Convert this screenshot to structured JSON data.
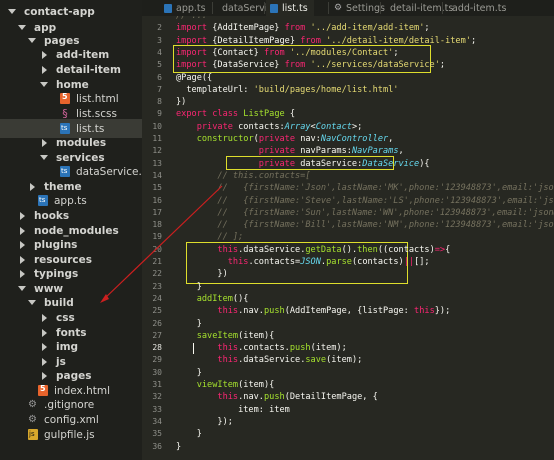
{
  "sidebar": {
    "items": [
      {
        "label": "contact-app",
        "kind": "folder-open",
        "indent": 0,
        "bold": true
      },
      {
        "label": "app",
        "kind": "folder-open",
        "indent": 1,
        "bold": true
      },
      {
        "label": "pages",
        "kind": "folder-open",
        "indent": 2,
        "bold": true
      },
      {
        "label": "add-item",
        "kind": "folder-closed",
        "indent": 3,
        "bold": true
      },
      {
        "label": "detail-item",
        "kind": "folder-closed",
        "indent": 3,
        "bold": true
      },
      {
        "label": "home",
        "kind": "folder-open",
        "indent": 3,
        "bold": true
      },
      {
        "label": "list.html",
        "kind": "html",
        "indent": 4,
        "bold": false
      },
      {
        "label": "list.scss",
        "kind": "scss",
        "indent": 4,
        "bold": false
      },
      {
        "label": "list.ts",
        "kind": "ts",
        "indent": 4,
        "bold": false,
        "selected": true
      },
      {
        "label": "modules",
        "kind": "folder-closed",
        "indent": 3,
        "bold": true
      },
      {
        "label": "services",
        "kind": "folder-open",
        "indent": 3,
        "bold": true
      },
      {
        "label": "dataService.ts",
        "kind": "ts",
        "indent": 4,
        "bold": false
      },
      {
        "label": "theme",
        "kind": "folder-closed",
        "indent": 2,
        "bold": true
      },
      {
        "label": "app.ts",
        "kind": "ts",
        "indent": 2,
        "bold": false
      },
      {
        "label": "hooks",
        "kind": "folder-closed",
        "indent": 1,
        "bold": true
      },
      {
        "label": "node_modules",
        "kind": "folder-closed",
        "indent": 1,
        "bold": true
      },
      {
        "label": "plugins",
        "kind": "folder-closed",
        "indent": 1,
        "bold": true
      },
      {
        "label": "resources",
        "kind": "folder-closed",
        "indent": 1,
        "bold": true
      },
      {
        "label": "typings",
        "kind": "folder-closed",
        "indent": 1,
        "bold": true
      },
      {
        "label": "www",
        "kind": "folder-open",
        "indent": 1,
        "bold": true
      },
      {
        "label": "build",
        "kind": "folder-open",
        "indent": 2,
        "bold": true
      },
      {
        "label": "css",
        "kind": "folder-closed",
        "indent": 3,
        "bold": true
      },
      {
        "label": "fonts",
        "kind": "folder-closed",
        "indent": 3,
        "bold": true
      },
      {
        "label": "img",
        "kind": "folder-closed",
        "indent": 3,
        "bold": true
      },
      {
        "label": "js",
        "kind": "folder-closed",
        "indent": 3,
        "bold": true
      },
      {
        "label": "pages",
        "kind": "folder-closed",
        "indent": 3,
        "bold": true
      },
      {
        "label": "index.html",
        "kind": "html",
        "indent": 2,
        "bold": false
      },
      {
        "label": ".gitignore",
        "kind": "gear",
        "indent": 1,
        "bold": false
      },
      {
        "label": "config.xml",
        "kind": "gear",
        "indent": 1,
        "bold": false
      },
      {
        "label": "gulpfile.js",
        "kind": "js",
        "indent": 1,
        "bold": false
      }
    ]
  },
  "tabs": [
    {
      "label": "app.ts",
      "icon": "ts-file-icon",
      "active": false
    },
    {
      "label": "dataService",
      "icon": "ts-file-icon",
      "active": false
    },
    {
      "label": "list.ts",
      "icon": "ts-file-icon",
      "active": true
    },
    {
      "label": "Settings",
      "icon": "gear-icon",
      "active": false
    },
    {
      "label": "detail-item.ts",
      "icon": "ts-file-icon",
      "active": false
    },
    {
      "label": "add-item.ts",
      "icon": "ts-file-icon",
      "active": false
    }
  ],
  "editor": {
    "current_line": "28",
    "lines": [
      {
        "n": "",
        "tokens": [
          [
            "c",
            "// ..."
          ]
        ]
      },
      {
        "n": "2",
        "tokens": [
          [
            "k",
            "import"
          ],
          [
            "t",
            " {AddItemPage} "
          ],
          [
            "k",
            "from"
          ],
          [
            "t",
            " "
          ],
          [
            "s",
            "'../add-item/add-item'"
          ],
          [
            "t",
            ";"
          ]
        ]
      },
      {
        "n": "3",
        "tokens": [
          [
            "k",
            "import"
          ],
          [
            "t",
            " {DetailItemPage} "
          ],
          [
            "k",
            "from"
          ],
          [
            "t",
            " "
          ],
          [
            "s",
            "'../detail-item/detail-item'"
          ],
          [
            "t",
            ";"
          ]
        ]
      },
      {
        "n": "4",
        "tokens": [
          [
            "k",
            "import"
          ],
          [
            "t",
            " {Contact} "
          ],
          [
            "k",
            "from"
          ],
          [
            "t",
            " "
          ],
          [
            "s",
            "'../modules/Contact'"
          ],
          [
            "t",
            ";"
          ]
        ]
      },
      {
        "n": "5",
        "tokens": [
          [
            "k",
            "import"
          ],
          [
            "t",
            " {DataService} "
          ],
          [
            "k",
            "from"
          ],
          [
            "t",
            " "
          ],
          [
            "s",
            "'../services/dataService'"
          ],
          [
            "t",
            ";"
          ]
        ]
      },
      {
        "n": "6",
        "tokens": [
          [
            "t",
            "@Page({"
          ]
        ]
      },
      {
        "n": "7",
        "tokens": [
          [
            "t",
            "  templateUrl: "
          ],
          [
            "s",
            "'build/pages/home/list.html'"
          ]
        ]
      },
      {
        "n": "8",
        "tokens": [
          [
            "t",
            "})"
          ]
        ]
      },
      {
        "n": "9",
        "tokens": [
          [
            "k",
            "export"
          ],
          [
            "t",
            " "
          ],
          [
            "k",
            "class"
          ],
          [
            "t",
            " "
          ],
          [
            "f",
            "ListPage"
          ],
          [
            "t",
            " {"
          ]
        ]
      },
      {
        "n": "10",
        "tokens": [
          [
            "t",
            "    "
          ],
          [
            "k",
            "private"
          ],
          [
            "t",
            " contacts:"
          ],
          [
            "y",
            "Array"
          ],
          [
            "t",
            "<"
          ],
          [
            "y",
            "Contact"
          ],
          [
            "t",
            ">;"
          ]
        ]
      },
      {
        "n": "11",
        "tokens": [
          [
            "t",
            "    "
          ],
          [
            "f",
            "constructor"
          ],
          [
            "t",
            "("
          ],
          [
            "k",
            "private"
          ],
          [
            "t",
            " nav:"
          ],
          [
            "y",
            "NavController"
          ],
          [
            "t",
            ","
          ]
        ]
      },
      {
        "n": "12",
        "tokens": [
          [
            "t",
            "                "
          ],
          [
            "k",
            "private"
          ],
          [
            "t",
            " navParams:"
          ],
          [
            "y",
            "NavParams"
          ],
          [
            "t",
            ","
          ]
        ]
      },
      {
        "n": "13",
        "tokens": [
          [
            "t",
            "                "
          ],
          [
            "k",
            "private"
          ],
          [
            "t",
            " dataService:"
          ],
          [
            "y",
            "DataService"
          ],
          [
            "t",
            "){"
          ]
        ]
      },
      {
        "n": "14",
        "tokens": [
          [
            "c",
            "        // this.contacts=["
          ]
        ]
      },
      {
        "n": "15",
        "tokens": [
          [
            "c",
            "        //   {firstName:'Json',lastName:'MK',phone:'123948873',email:'json@apple.com'},"
          ]
        ]
      },
      {
        "n": "16",
        "tokens": [
          [
            "c",
            "        //   {firstName:'Steve',lastName:'LS',phone:'123948873',email:'json@apple.com'},"
          ]
        ]
      },
      {
        "n": "17",
        "tokens": [
          [
            "c",
            "        //   {firstName:'Sun',lastName:'WN',phone:'123948873',email:'json@apple.com'},"
          ]
        ]
      },
      {
        "n": "18",
        "tokens": [
          [
            "c",
            "        //   {firstName:'Bill',lastName:'NM',phone:'123948873',email:'json@apple.com'}"
          ]
        ]
      },
      {
        "n": "19",
        "tokens": [
          [
            "c",
            "        // ];"
          ]
        ]
      },
      {
        "n": "20",
        "tokens": [
          [
            "t",
            "        "
          ],
          [
            "k",
            "this"
          ],
          [
            "t",
            ".dataService."
          ],
          [
            "f",
            "getData"
          ],
          [
            "t",
            "()."
          ],
          [
            "f",
            "then"
          ],
          [
            "t",
            "((contacts)"
          ],
          [
            "k",
            "=>"
          ],
          [
            "t",
            "{"
          ]
        ]
      },
      {
        "n": "21",
        "tokens": [
          [
            "t",
            "          "
          ],
          [
            "k",
            "this"
          ],
          [
            "t",
            ".contacts="
          ],
          [
            "y",
            "JSON"
          ],
          [
            "t",
            "."
          ],
          [
            "f",
            "parse"
          ],
          [
            "t",
            "(contacts)"
          ],
          [
            "k",
            "||"
          ],
          [
            "t",
            "[];"
          ]
        ]
      },
      {
        "n": "22",
        "tokens": [
          [
            "t",
            "        })"
          ]
        ]
      },
      {
        "n": "23",
        "tokens": [
          [
            "t",
            "    }"
          ]
        ]
      },
      {
        "n": "24",
        "tokens": [
          [
            "t",
            "    "
          ],
          [
            "f",
            "addItem"
          ],
          [
            "t",
            "(){"
          ]
        ]
      },
      {
        "n": "25",
        "tokens": [
          [
            "t",
            "        "
          ],
          [
            "k",
            "this"
          ],
          [
            "t",
            ".nav."
          ],
          [
            "f",
            "push"
          ],
          [
            "t",
            "(AddItemPage, {listPage: "
          ],
          [
            "k",
            "this"
          ],
          [
            "t",
            "});"
          ]
        ]
      },
      {
        "n": "26",
        "tokens": [
          [
            "t",
            "    }"
          ]
        ]
      },
      {
        "n": "27",
        "tokens": [
          [
            "t",
            "    "
          ],
          [
            "f",
            "saveItem"
          ],
          [
            "t",
            "(item){"
          ]
        ]
      },
      {
        "n": "28",
        "tokens": [
          [
            "t",
            "        "
          ],
          [
            "k",
            "this"
          ],
          [
            "t",
            ".contacts."
          ],
          [
            "f",
            "push"
          ],
          [
            "t",
            "(item);"
          ]
        ]
      },
      {
        "n": "29",
        "tokens": [
          [
            "t",
            "        "
          ],
          [
            "k",
            "this"
          ],
          [
            "t",
            ".dataService."
          ],
          [
            "f",
            "save"
          ],
          [
            "t",
            "(item);"
          ]
        ]
      },
      {
        "n": "30",
        "tokens": [
          [
            "t",
            "    }"
          ]
        ]
      },
      {
        "n": "31",
        "tokens": [
          [
            "t",
            "    "
          ],
          [
            "f",
            "viewItem"
          ],
          [
            "t",
            "(item){"
          ]
        ]
      },
      {
        "n": "32",
        "tokens": [
          [
            "t",
            "        "
          ],
          [
            "k",
            "this"
          ],
          [
            "t",
            ".nav."
          ],
          [
            "f",
            "push"
          ],
          [
            "t",
            "(DetailItemPage, {"
          ]
        ]
      },
      {
        "n": "33",
        "tokens": [
          [
            "t",
            "            item: item"
          ]
        ]
      },
      {
        "n": "34",
        "tokens": [
          [
            "t",
            "        });"
          ]
        ]
      },
      {
        "n": "35",
        "tokens": [
          [
            "t",
            "    }"
          ]
        ]
      },
      {
        "n": "36",
        "tokens": [
          [
            "t",
            "}"
          ]
        ]
      }
    ]
  },
  "colors": {
    "keyword": "#f92672",
    "string": "#e6db74",
    "function": "#a6e22e",
    "type": "#66d9ef",
    "comment": "#75715e",
    "text": "#f8f8f2",
    "highlight_box": "#dede2c",
    "annotation_arrow": "#cc1f1f"
  }
}
